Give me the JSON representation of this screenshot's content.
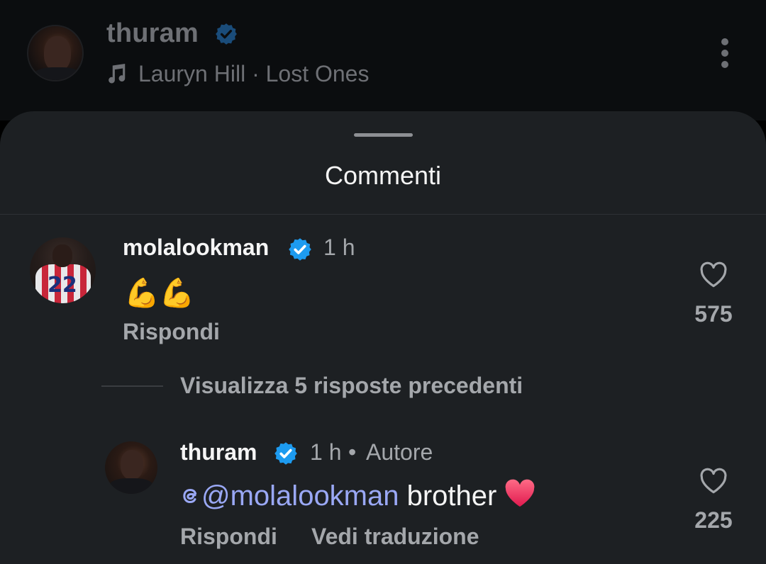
{
  "post_header": {
    "username": "thuram",
    "song": "Lauryn Hill · Lost Ones"
  },
  "sheet": {
    "title": "Commenti"
  },
  "comments": [
    {
      "username": "molalookman",
      "time": "1 h",
      "text": "💪💪",
      "reply_label": "Rispondi",
      "likes": "575",
      "avatar_number": "22"
    }
  ],
  "view_replies_label": "Visualizza 5 risposte precedenti",
  "reply": {
    "username": "thuram",
    "time": "1 h",
    "separator": "•",
    "author_label": "Autore",
    "mention": "@molalookman",
    "text": " brother",
    "reply_label": "Rispondi",
    "translate_label": "Vedi traduzione",
    "likes": "225"
  },
  "colors": {
    "sheet_bg": "#1d2023",
    "verified_blue": "#1d9bf0",
    "mention": "#9aa8f5",
    "muted_text": "#a4a7ab"
  },
  "icons": [
    "music-note-icon",
    "verified-badge-icon",
    "more-options-icon",
    "heart-outline-icon",
    "threads-at-icon",
    "red-heart-emoji"
  ]
}
